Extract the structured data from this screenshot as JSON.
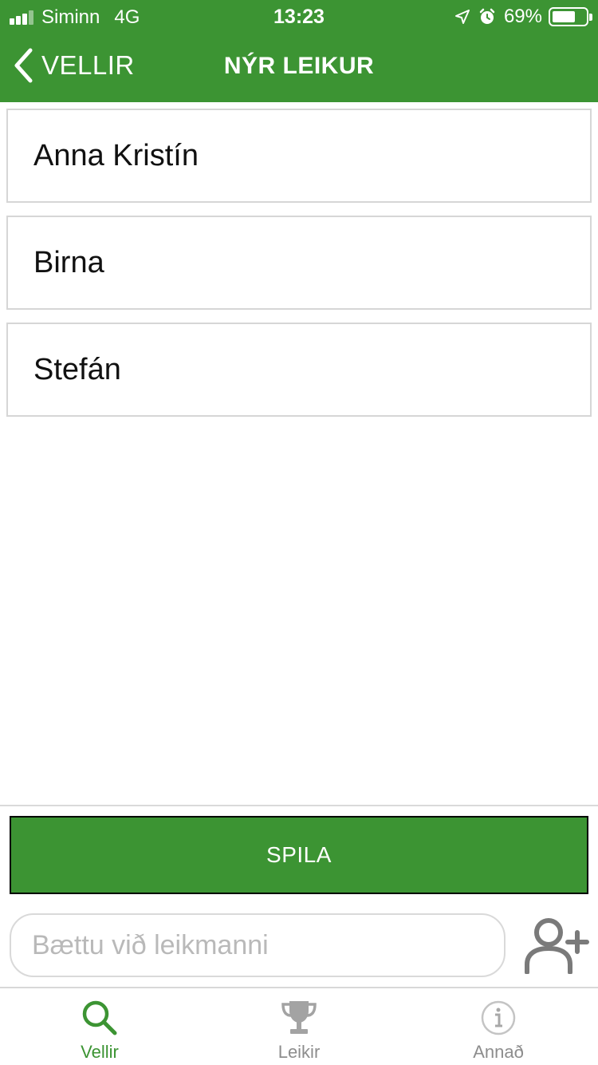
{
  "status_bar": {
    "carrier": "Siminn",
    "network": "4G",
    "time": "13:23",
    "battery_percent": "69%",
    "battery_level": 0.69,
    "signal_bars_filled": 3,
    "signal_bars_total": 4
  },
  "nav": {
    "back_label": "VELLIR",
    "title": "NÝR LEIKUR"
  },
  "players": [
    {
      "name": "Anna Kristín"
    },
    {
      "name": "Birna"
    },
    {
      "name": "Stefán"
    }
  ],
  "actions": {
    "play_label": "SPILA"
  },
  "add_player": {
    "value": "",
    "placeholder": "Bættu við leikmanni"
  },
  "tabs": [
    {
      "label": "Vellir",
      "icon": "search-icon",
      "active": true
    },
    {
      "label": "Leikir",
      "icon": "trophy-icon",
      "active": false
    },
    {
      "label": "Annað",
      "icon": "info-icon",
      "active": false
    }
  ],
  "colors": {
    "brand_green": "#3c9433",
    "inactive_gray": "#8d8d8d",
    "border_gray": "#d6d6d6"
  }
}
